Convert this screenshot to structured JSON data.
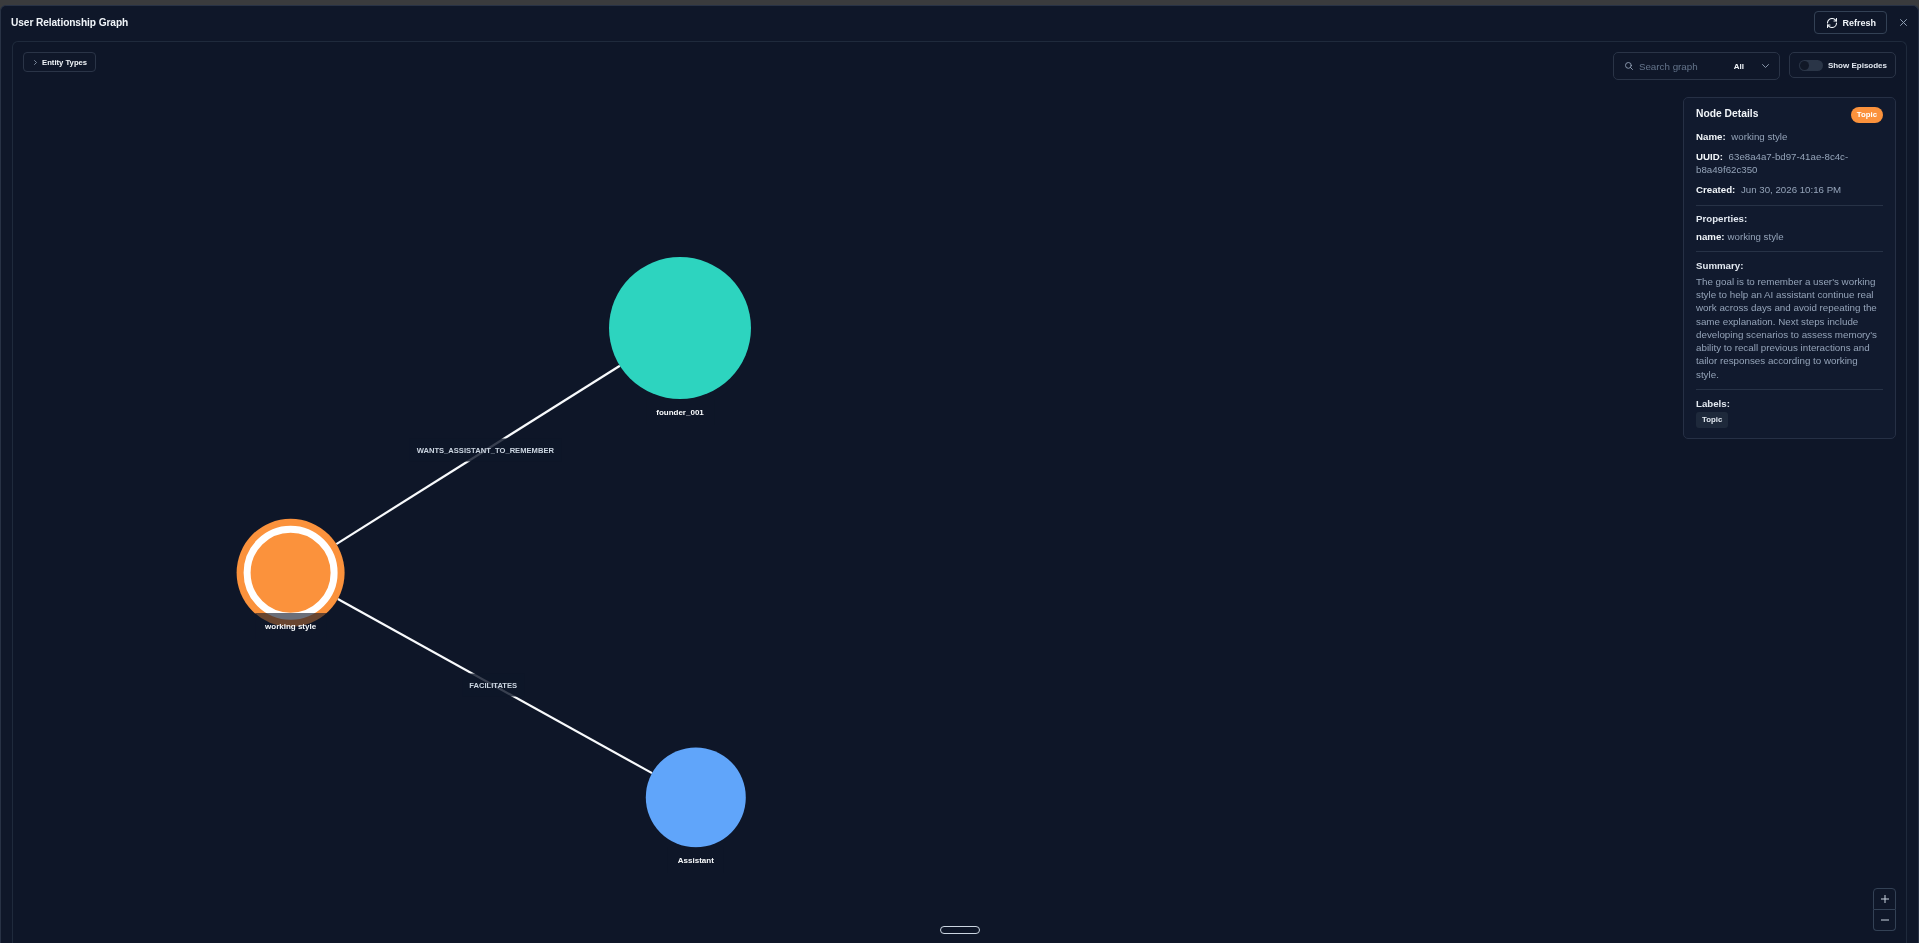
{
  "window": {
    "title": "User Relationship Graph",
    "refresh_label": "Refresh"
  },
  "toolbar": {
    "entity_types": {
      "label": "Entity Types",
      "expanded": false
    },
    "search": {
      "placeholder": "Search graph",
      "filter": "All"
    },
    "show_episodes": {
      "label": "Show Episodes",
      "on": false
    }
  },
  "graph": {
    "nodes": [
      {
        "label": "founder_001",
        "color": "#2dd4bf",
        "selected": false
      },
      {
        "label": "working style",
        "color": "#fb923c",
        "selected": true
      },
      {
        "label": "Assistant",
        "color": "#60a5fa",
        "selected": false
      }
    ],
    "edges": [
      {
        "label": "WANTS_ASSISTANT_TO_REMEMBER"
      },
      {
        "label": "FACILITATES"
      }
    ]
  },
  "node_details": {
    "title": "Node Details",
    "type_badge": "Topic",
    "fields": [
      {
        "label": "Name:",
        "value": "working style"
      },
      {
        "label": "UUID:",
        "value": "63e8a4a7-bd97-41ae-8c4c-b8a49f62c350"
      },
      {
        "label": "Created:",
        "value": "Jun 30, 2026 10:16 PM"
      }
    ],
    "properties_heading": "Properties:",
    "properties": [
      {
        "key": "name:",
        "value": "working style"
      }
    ],
    "summary_heading": "Summary:",
    "summary": "The goal is to remember a user's working style to help an AI assistant continue real work across days and avoid repeating the same explanation. Next steps include developing scenarios to assess memory's ability to recall previous interactions and tailor responses according to working style.",
    "labels_heading": "Labels:",
    "labels": [
      "Topic"
    ]
  }
}
